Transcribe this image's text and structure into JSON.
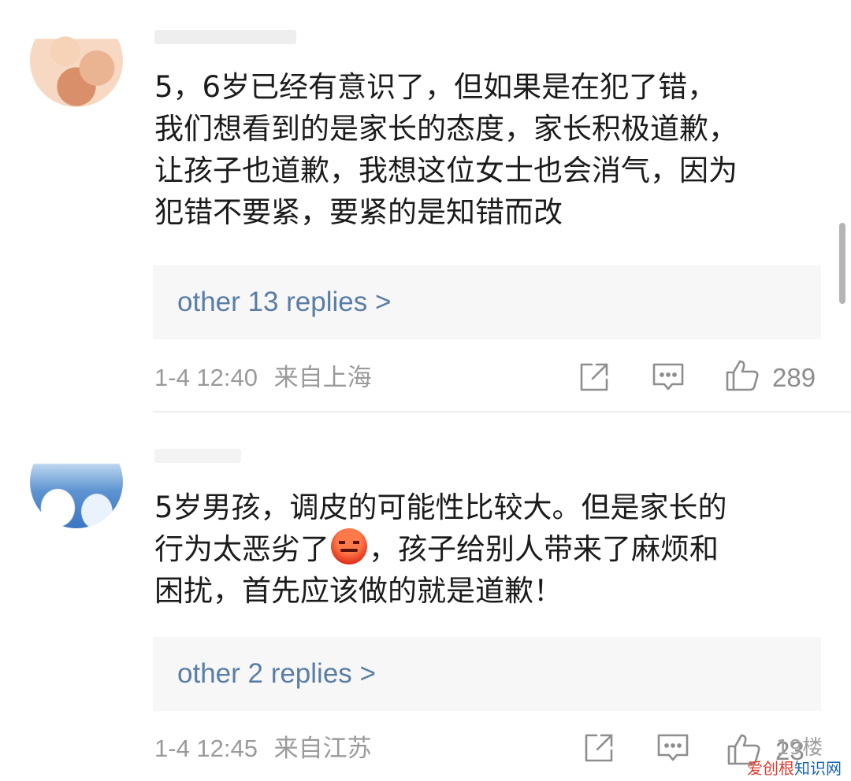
{
  "comments": [
    {
      "text": "5，6岁已经有意识了，但如果是在犯了错，\n我们想看到的是家长的态度，家长积极道歉，\n让孩子也道歉，我想这位女士也会消气，因为\n犯错不要紧，要紧的是知错而改",
      "replies_label": "other 13 replies >",
      "time": "1-4 12:40",
      "location": "来自上海",
      "likes": "289"
    },
    {
      "text_before_emoji": "5岁男孩，调皮的可能性比较大。但是家长的\n行为太恶劣了",
      "text_after_emoji": "，孩子给别人带来了麻烦和\n困扰，首先应该做的就是道歉！",
      "emoji": "angry-face-emoji",
      "replies_label": "other 2 replies >",
      "time": "1-4 12:45",
      "location": "来自江苏",
      "likes": "23"
    }
  ],
  "floor_label": "19楼",
  "watermark": {
    "brand_part1": "爱创根",
    "brand_part2": "知识网"
  },
  "icons": {
    "share": "share-icon",
    "comment": "comment-icon",
    "like": "thumbs-up-icon"
  },
  "colors": {
    "reply_link": "#5a7da6",
    "meta_text": "#9a9a9a",
    "reply_box_bg": "#f7f7f7"
  }
}
